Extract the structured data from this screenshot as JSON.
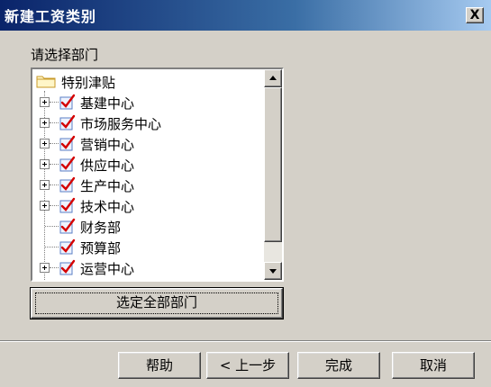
{
  "window": {
    "title": "新建工资类别",
    "close_glyph": "X"
  },
  "prompt_label": "请选择部门",
  "tree": {
    "root_label": "特别津贴",
    "items": [
      {
        "label": "基建中心",
        "expandable": true,
        "checked": true
      },
      {
        "label": "市场服务中心",
        "expandable": true,
        "checked": true
      },
      {
        "label": "营销中心",
        "expandable": true,
        "checked": true
      },
      {
        "label": "供应中心",
        "expandable": true,
        "checked": true
      },
      {
        "label": "生产中心",
        "expandable": true,
        "checked": true
      },
      {
        "label": "技术中心",
        "expandable": true,
        "checked": true
      },
      {
        "label": "财务部",
        "expandable": false,
        "checked": true
      },
      {
        "label": "预算部",
        "expandable": false,
        "checked": true
      },
      {
        "label": "运营中心",
        "expandable": true,
        "checked": true
      }
    ]
  },
  "scrollbar": {
    "up_glyph": "▲",
    "down_glyph": "▼"
  },
  "select_all_label": "选定全部部门",
  "footer": {
    "help_label": "帮助",
    "back_label": "< 上一步",
    "finish_label": "完成",
    "cancel_label": "取消"
  },
  "colors": {
    "title_bar": "#0a246a",
    "check_red": "#d40000",
    "check_box": "#5b7fc4"
  }
}
